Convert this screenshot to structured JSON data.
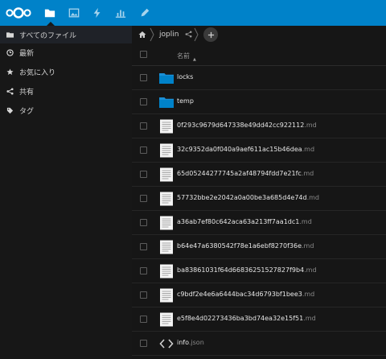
{
  "header": {
    "logo": "nextcloud-logo",
    "apps": [
      {
        "name": "files-app-icon",
        "active": true
      },
      {
        "name": "photos-app-icon",
        "active": false
      },
      {
        "name": "activity-app-icon",
        "active": false
      },
      {
        "name": "monitoring-app-icon",
        "active": false
      },
      {
        "name": "notes-app-icon",
        "active": false
      }
    ],
    "accent_color": "#0082c9"
  },
  "sidebar": {
    "items": [
      {
        "label": "すべてのファイル",
        "icon": "folder-icon",
        "active": true
      },
      {
        "label": "最新",
        "icon": "clock-icon",
        "active": false
      },
      {
        "label": "お気に入り",
        "icon": "star-icon",
        "active": false
      },
      {
        "label": "共有",
        "icon": "share-icon",
        "active": false
      },
      {
        "label": "タグ",
        "icon": "tag-icon",
        "active": false
      }
    ]
  },
  "breadcrumb": {
    "home_icon": "home-icon",
    "folder": "joplin",
    "share_icon": "share-icon",
    "add_icon": "plus-icon"
  },
  "table": {
    "column_name": "名前",
    "sort_indicator": "▲",
    "files": [
      {
        "name": "locks",
        "ext": "",
        "type": "folder"
      },
      {
        "name": "temp",
        "ext": "",
        "type": "folder"
      },
      {
        "name": "0f293c9679d647338e49dd42cc922112",
        "ext": ".md",
        "type": "text"
      },
      {
        "name": "32c9352da0f040a9aef611ac15b46dea",
        "ext": ".md",
        "type": "text"
      },
      {
        "name": "65d05244277745a2af48794fdd7e21fc",
        "ext": ".md",
        "type": "text"
      },
      {
        "name": "57732bbe2e2042a0a00be3a685d4e74d",
        "ext": ".md",
        "type": "text"
      },
      {
        "name": "a36ab7ef80c642aca63a213ff7aa1dc1",
        "ext": ".md",
        "type": "text"
      },
      {
        "name": "b64e47a6380542f78e1a6ebf8270f36e",
        "ext": ".md",
        "type": "text"
      },
      {
        "name": "ba83861031f64d66836251527827f9b4",
        "ext": ".md",
        "type": "text"
      },
      {
        "name": "c9bdf2e4e6a6444bac34d6793bf1bee3",
        "ext": ".md",
        "type": "text"
      },
      {
        "name": "e5f8e4d02273436ba3bd74ea32e15f51",
        "ext": ".md",
        "type": "text"
      },
      {
        "name": "info",
        "ext": ".json",
        "type": "code"
      }
    ]
  }
}
